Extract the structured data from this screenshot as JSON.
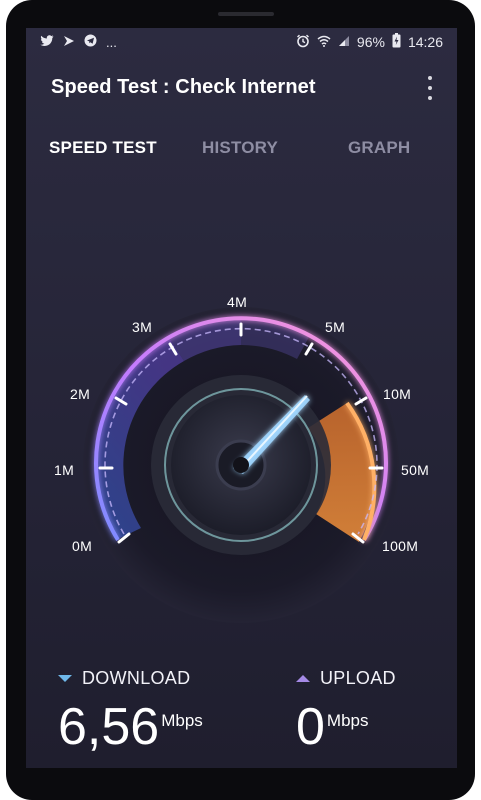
{
  "status": {
    "icons_left": [
      "twitter-icon",
      "vpn-icon",
      "telegram-icon"
    ],
    "more": "...",
    "battery": "96%",
    "time": "14:26"
  },
  "app": {
    "title": "Speed Test : Check Internet"
  },
  "tabs": [
    {
      "label": "SPEED TEST",
      "active": true
    },
    {
      "label": "HISTORY",
      "active": false
    },
    {
      "label": "GRAPH",
      "active": false
    }
  ],
  "gauge": {
    "scale_labels": [
      "0M",
      "1M",
      "2M",
      "3M",
      "4M",
      "5M",
      "10M",
      "50M",
      "100M"
    ],
    "needle_position": "between 4M and 5M"
  },
  "download": {
    "label": "DOWNLOAD",
    "value": "6,56",
    "unit": "Mbps"
  },
  "upload": {
    "label": "UPLOAD",
    "value": "0",
    "unit": "Mbps"
  },
  "colors": {
    "accent_purple": "#b46cf5",
    "accent_orange": "#f0863a",
    "needle": "#9fd6ff",
    "download": "#6fb8ea",
    "upload": "#a58ae6"
  }
}
